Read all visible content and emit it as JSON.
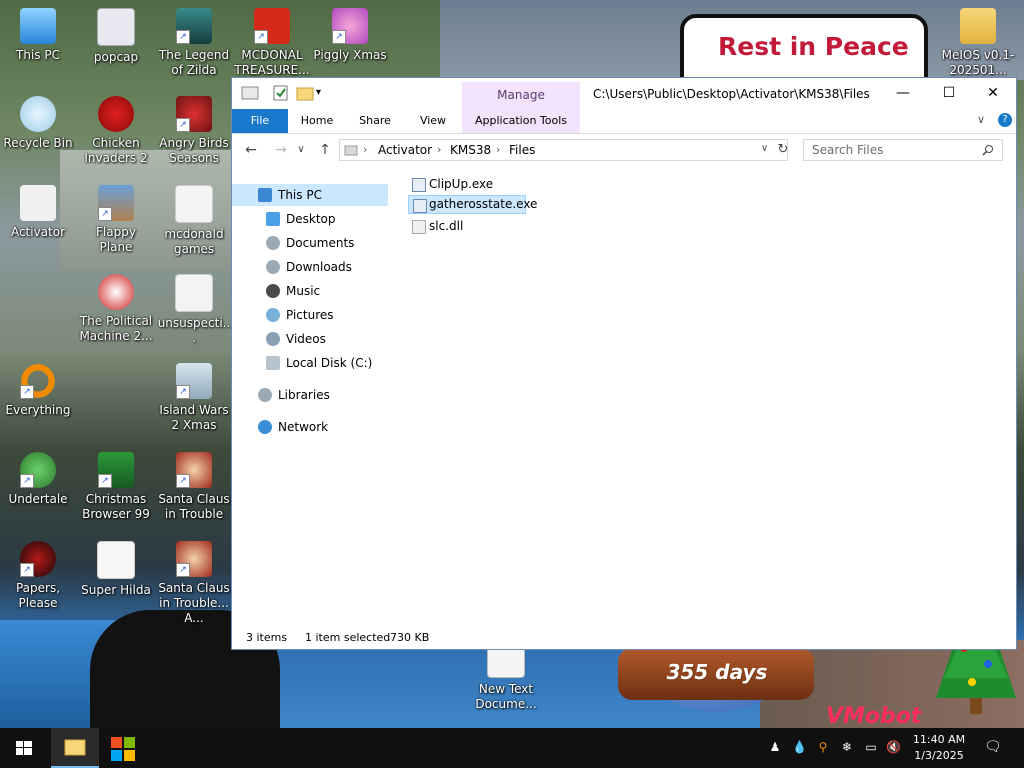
{
  "desktop": {
    "sign_text": "Rest in Peace",
    "icons": [
      {
        "label": "This PC"
      },
      {
        "label": "popcap"
      },
      {
        "label": "The Legend of Zilda"
      },
      {
        "label": "MCDONAL TREASURE..."
      },
      {
        "label": "Piggly Xmas"
      },
      {
        "label": "MeIOS v0.1-202501..."
      },
      {
        "label": "Recycle Bin"
      },
      {
        "label": "Chicken Invaders 2"
      },
      {
        "label": "Angry Birds Seasons"
      },
      {
        "label": "Activator"
      },
      {
        "label": "Flappy Plane"
      },
      {
        "label": "mcdonald games"
      },
      {
        "label": "The Political Machine 2..."
      },
      {
        "label": "unsuspecti..."
      },
      {
        "label": "Everything"
      },
      {
        "label": "Island Wars 2 Xmas"
      },
      {
        "label": "Undertale"
      },
      {
        "label": "Christmas Browser 99"
      },
      {
        "label": "Santa Claus in Trouble"
      },
      {
        "label": "Papers, Please"
      },
      {
        "label": "Super Hilda"
      },
      {
        "label": "Santa Claus in Trouble... A..."
      },
      {
        "label": "New Text Docume..."
      }
    ],
    "globe_text": "355 days",
    "watermark": "VMobot"
  },
  "explorer": {
    "title_path": "C:\\Users\\Public\\Desktop\\Activator\\KMS38\\Files",
    "manage_label": "Manage",
    "window_controls": {
      "minimize": "—",
      "maximize": "☐",
      "close": "✕"
    },
    "ribbon_tabs": {
      "file": "File",
      "home": "Home",
      "share": "Share",
      "view": "View",
      "application_tools": "Application Tools"
    },
    "breadcrumb": [
      "Activator",
      "KMS38",
      "Files"
    ],
    "search_placeholder": "Search Files",
    "nav_items": [
      {
        "label": "This PC"
      },
      {
        "label": "Desktop"
      },
      {
        "label": "Documents"
      },
      {
        "label": "Downloads"
      },
      {
        "label": "Music"
      },
      {
        "label": "Pictures"
      },
      {
        "label": "Videos"
      },
      {
        "label": "Local Disk (C:)"
      },
      {
        "label": "Libraries"
      },
      {
        "label": "Network"
      }
    ],
    "files": [
      {
        "name": "ClipUp.exe"
      },
      {
        "name": "gatherosstate.exe"
      },
      {
        "name": "slc.dll"
      }
    ],
    "status": {
      "items": "3 items",
      "selected": "1 item selected",
      "size": "730 KB"
    }
  },
  "taskbar": {
    "time": "11:40 AM",
    "date": "1/3/2025"
  }
}
